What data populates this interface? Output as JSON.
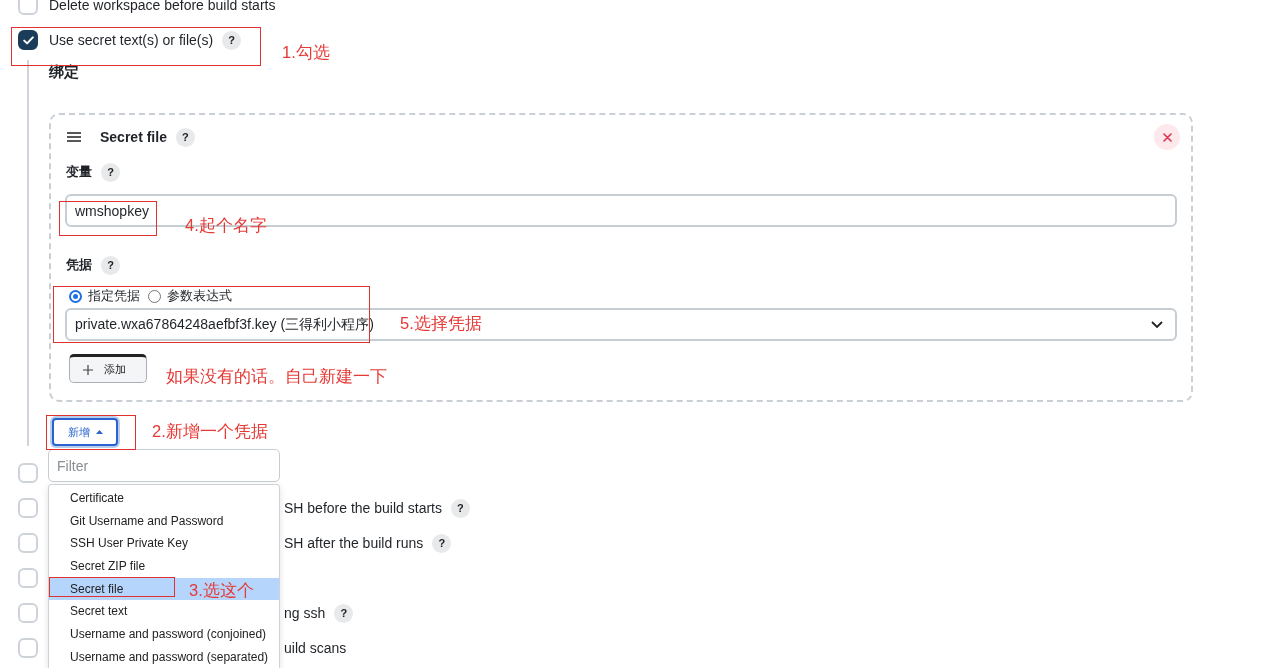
{
  "options": [
    {
      "label": "Delete workspace before build starts",
      "checked": false
    },
    {
      "label": "Use secret text(s) or file(s)",
      "checked": true,
      "help": "?",
      "bindings": {
        "heading": "绑定",
        "card": {
          "title": "Secret file",
          "help": "?",
          "fields": [
            {
              "kind": "text",
              "label": "变量",
              "help": "?",
              "value": "wmshopkey"
            },
            {
              "kind": "credentials",
              "label": "凭据",
              "help": "?",
              "radios": [
                {
                  "label": "指定凭据",
                  "selected": true
                },
                {
                  "label": "参数表达式",
                  "selected": false
                }
              ],
              "value": "private.wxa67864248aefbf3f.key (三得利小程序)",
              "add_button": "添加"
            }
          ]
        },
        "add_button": {
          "label": "新增",
          "expanded": true
        },
        "dropdown": {
          "filter": {
            "placeholder": "Filter"
          },
          "items": [
            {
              "label": "Certificate",
              "selected": false
            },
            {
              "label": "Git Username and Password",
              "selected": false
            },
            {
              "label": "SSH User Private Key",
              "selected": false
            },
            {
              "label": "Secret ZIP file",
              "selected": false
            },
            {
              "label": "Secret file",
              "selected": true
            },
            {
              "label": "Secret text",
              "selected": false
            },
            {
              "label": "Username and password (conjoined)",
              "selected": false
            },
            {
              "label": "Username and password (separated)",
              "selected": false
            }
          ]
        }
      }
    }
  ],
  "more_options": [
    {
      "checked": false
    },
    {
      "label": "SH before the build starts",
      "help": "?",
      "checked": false
    },
    {
      "label": "SH after the build runs",
      "help": "?",
      "checked": false
    },
    {
      "checked": false
    },
    {
      "label": "ng ssh",
      "help": "?",
      "checked": false
    },
    {
      "label": "uild scans",
      "checked": false
    }
  ],
  "annotations": [
    {
      "kind": "box"
    },
    {
      "kind": "text",
      "text": "1.勾选"
    },
    {
      "kind": "box"
    },
    {
      "kind": "text",
      "text": "4.起个名字"
    },
    {
      "kind": "box"
    },
    {
      "kind": "text",
      "text": "5.选择凭据"
    },
    {
      "kind": "text",
      "text": "如果没有的话。自己新建一下"
    },
    {
      "kind": "box"
    },
    {
      "kind": "text",
      "text": "2.新增一个凭据"
    },
    {
      "kind": "box"
    },
    {
      "kind": "text",
      "text": "3.选这个"
    }
  ]
}
